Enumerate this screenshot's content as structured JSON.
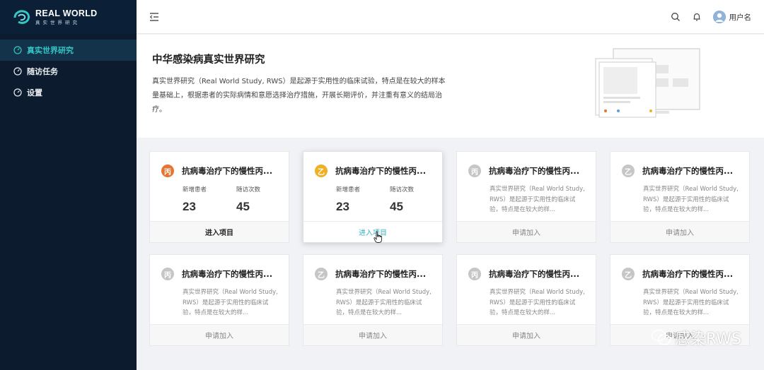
{
  "app": {
    "logo_en": "REAL WORLD",
    "logo_cn": "真实世界研究",
    "username": "用户名"
  },
  "sidebar": {
    "items": [
      {
        "label": "真实世界研究",
        "icon": "dashboard-icon",
        "active": true
      },
      {
        "label": "随访任务",
        "icon": "dashboard-icon",
        "active": false
      },
      {
        "label": "设置",
        "icon": "dashboard-icon",
        "active": false
      }
    ]
  },
  "banner": {
    "title": "中华感染病真实世界研究",
    "description": "真实世界研究（Real World Study, RWS）是起源于实用性的临床试验，特点是在较大的样本量基础上，根据患者的实际病情和意愿选择治疗措施，开展长期评价，并注重有意义的结局治疗。"
  },
  "cards": [
    {
      "badge": "丙",
      "badge_color": "#e8742e",
      "title": "抗病毒治疗下的慢性丙...",
      "stat1_label": "新增患者",
      "stat1_value": "23",
      "stat2_label": "随访次数",
      "stat2_value": "45",
      "action": "进入项目"
    },
    {
      "badge": "乙",
      "badge_color": "#f0b023",
      "title": "抗病毒治疗下的慢性丙...",
      "stat1_label": "新增患者",
      "stat1_value": "23",
      "stat2_label": "随访次数",
      "stat2_value": "45",
      "action": "进入项目"
    },
    {
      "badge": "丙",
      "badge_color": "#c6c6c6",
      "title": "抗病毒治疗下的慢性丙...",
      "desc": "真实世界研究（Real World Study, RWS）是起源于实用性的临床试验，特点是在较大的样...",
      "action": "申请加入"
    },
    {
      "badge": "乙",
      "badge_color": "#c6c6c6",
      "title": "抗病毒治疗下的慢性丙...",
      "desc": "真实世界研究（Real World Study, RWS）是起源于实用性的临床试验，特点是在较大的样...",
      "action": "申请加入"
    },
    {
      "badge": "丙",
      "badge_color": "#c6c6c6",
      "title": "抗病毒治疗下的慢性丙...",
      "desc": "真实世界研究（Real World Study, RWS）是起源于实用性的临床试验，特点是在较大的样...",
      "action": "申请加入"
    },
    {
      "badge": "乙",
      "badge_color": "#c6c6c6",
      "title": "抗病毒治疗下的慢性丙...",
      "desc": "真实世界研究（Real World Study, RWS）是起源于实用性的临床试验，特点是在较大的样...",
      "action": "申请加入"
    },
    {
      "badge": "丙",
      "badge_color": "#c6c6c6",
      "title": "抗病毒治疗下的慢性丙...",
      "desc": "真实世界研究（Real World Study, RWS）是起源于实用性的临床试验，特点是在较大的样...",
      "action": "申请加入"
    },
    {
      "badge": "乙",
      "badge_color": "#c6c6c6",
      "title": "抗病毒治疗下的慢性丙...",
      "desc": "真实世界研究（Real World Study, RWS）是起源于实用性的临床试验，特点是在较大的样...",
      "action": "申请加入"
    }
  ],
  "watermark": "感染RWS"
}
